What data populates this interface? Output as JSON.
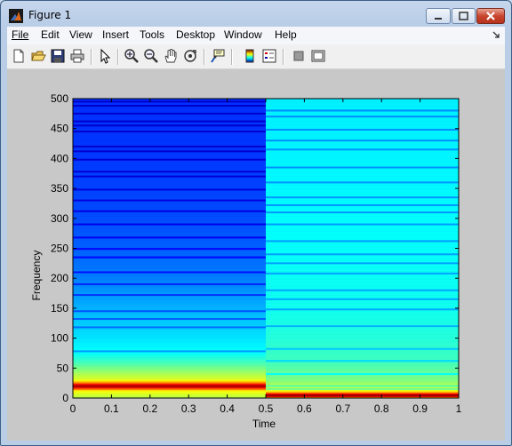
{
  "window": {
    "title": "Figure 1",
    "icon": "matlab-logo-icon"
  },
  "menu": {
    "items": [
      "File",
      "Edit",
      "View",
      "Insert",
      "Tools",
      "Desktop",
      "Window",
      "Help"
    ]
  },
  "toolbar": {
    "buttons": [
      "new-figure-icon",
      "open-file-icon",
      "save-icon",
      "print-icon",
      "edit-plot-arrow-icon",
      "zoom-in-icon",
      "zoom-out-icon",
      "pan-hand-icon",
      "rotate-3d-icon",
      "data-cursor-icon",
      "insert-colorbar-icon",
      "insert-legend-icon",
      "hide-plot-tools-icon",
      "show-plot-tools-icon"
    ]
  },
  "colors": {
    "figure_bg": "#c8c8c8",
    "colormap": "jet"
  },
  "chart_data": {
    "type": "heatmap",
    "title": "",
    "xlabel": "Time",
    "ylabel": "Frequency",
    "xlim": [
      0,
      1
    ],
    "ylim": [
      0,
      500
    ],
    "xticks": [
      "0",
      "0.1",
      "0.2",
      "0.3",
      "0.4",
      "0.5",
      "0.6",
      "0.7",
      "0.8",
      "0.9",
      "1"
    ],
    "yticks": [
      "0",
      "50",
      "100",
      "150",
      "200",
      "250",
      "300",
      "350",
      "400",
      "450",
      "500"
    ],
    "grid": false,
    "segments": [
      {
        "x": [
          0,
          0.5
        ],
        "dominant_frequency": 20,
        "intensity_profile": [
          {
            "f": 0,
            "level": 0.55
          },
          {
            "f": 12,
            "level": 0.62
          },
          {
            "f": 16,
            "level": 0.8
          },
          {
            "f": 20,
            "level": 1.0
          },
          {
            "f": 25,
            "level": 0.78
          },
          {
            "f": 30,
            "level": 0.6
          },
          {
            "f": 45,
            "level": 0.52
          },
          {
            "f": 60,
            "level": 0.44
          },
          {
            "f": 75,
            "level": 0.38
          },
          {
            "f": 100,
            "level": 0.35
          },
          {
            "f": 150,
            "level": 0.3
          },
          {
            "f": 200,
            "level": 0.25
          },
          {
            "f": 250,
            "level": 0.22
          },
          {
            "f": 300,
            "level": 0.2
          },
          {
            "f": 400,
            "level": 0.18
          },
          {
            "f": 500,
            "level": 0.17
          }
        ],
        "dark_lines": [
          78,
          118,
          132,
          145,
          172,
          190,
          210,
          235,
          249,
          268,
          290,
          312,
          330,
          348,
          370,
          378,
          398,
          412,
          420,
          445,
          455,
          462,
          475,
          488,
          495
        ]
      },
      {
        "x": [
          0.5,
          1
        ],
        "dominant_frequency": 5,
        "intensity_profile": [
          {
            "f": 0,
            "level": 0.65
          },
          {
            "f": 3,
            "level": 0.9
          },
          {
            "f": 5,
            "level": 1.0
          },
          {
            "f": 8,
            "level": 0.82
          },
          {
            "f": 12,
            "level": 0.6
          },
          {
            "f": 30,
            "level": 0.5
          },
          {
            "f": 60,
            "level": 0.44
          },
          {
            "f": 100,
            "level": 0.41
          },
          {
            "f": 150,
            "level": 0.39
          },
          {
            "f": 250,
            "level": 0.38
          },
          {
            "f": 350,
            "level": 0.37
          },
          {
            "f": 500,
            "level": 0.36
          }
        ],
        "dark_lines": [
          15,
          20,
          40,
          62,
          82,
          120,
          148,
          165,
          180,
          208,
          225,
          240,
          262,
          290,
          310,
          322,
          335,
          360,
          385,
          415,
          430,
          448,
          470,
          480
        ]
      }
    ]
  }
}
